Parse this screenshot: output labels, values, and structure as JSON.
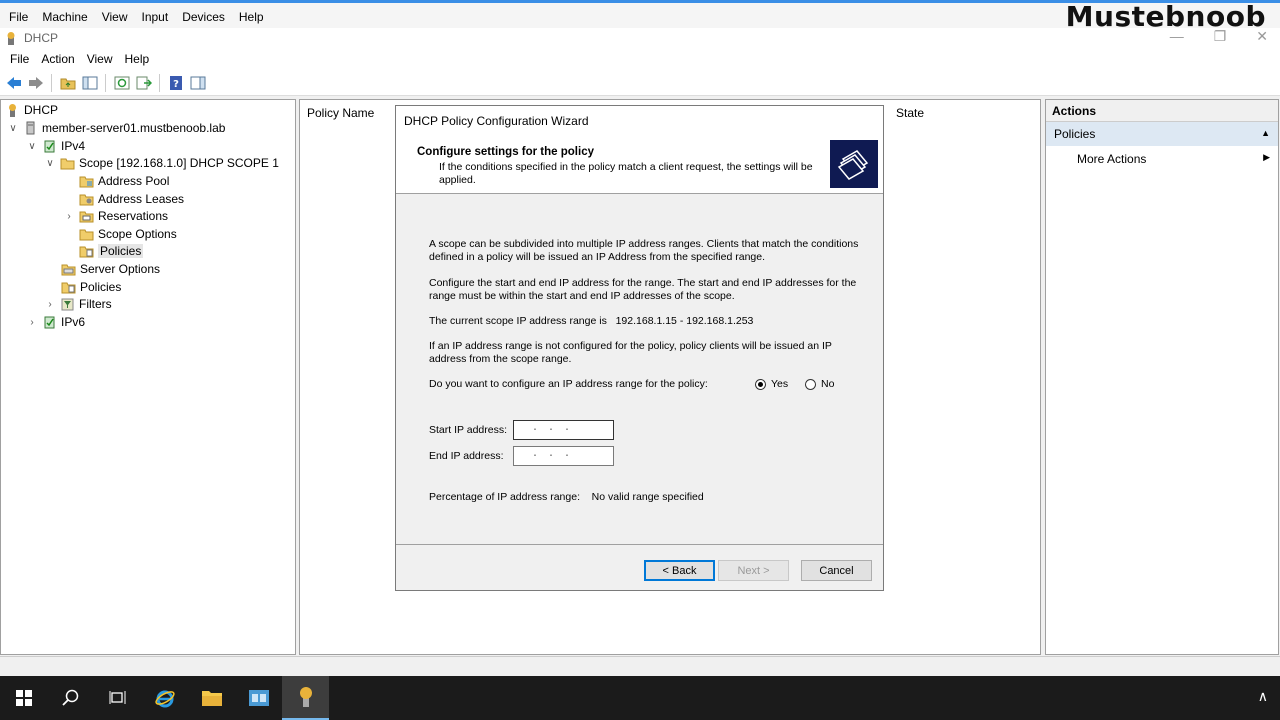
{
  "vm_menu": [
    "File",
    "Machine",
    "View",
    "Input",
    "Devices",
    "Help"
  ],
  "watermark": "Mustebnoob",
  "window": {
    "title": "DHCP"
  },
  "menu": [
    "File",
    "Action",
    "View",
    "Help"
  ],
  "tree": {
    "root": "DHCP",
    "server": "member-server01.mustbenoob.lab",
    "ipv4": "IPv4",
    "scope": "Scope [192.168.1.0] DHCP SCOPE 1",
    "address_pool": "Address Pool",
    "address_leases": "Address Leases",
    "reservations": "Reservations",
    "scope_options": "Scope Options",
    "policies_scope": "Policies",
    "server_options": "Server Options",
    "policies_server": "Policies",
    "filters": "Filters",
    "ipv6": "IPv6"
  },
  "center": {
    "col_policy_name": "Policy Name",
    "col_state": "State"
  },
  "actions": {
    "title": "Actions",
    "section": "Policies",
    "more_actions": "More Actions"
  },
  "wizard": {
    "title": "DHCP Policy Configuration Wizard",
    "header_title": "Configure settings for the policy",
    "header_sub": "If the conditions specified in the policy match a client request, the settings will be applied.",
    "p1": "A scope can be subdivided into multiple IP address ranges. Clients that match the conditions defined in a policy will be issued an IP Address from the specified range.",
    "p2": "Configure the start and end IP address for the range. The start and end IP addresses for the range must be within the start and end IP addresses of the scope.",
    "p3_label": "The current scope IP address range is",
    "p3_value": "192.168.1.15 - 192.168.1.253",
    "p4": "If an IP address range is not configured for the policy, policy clients will be issued an IP address from the scope range.",
    "question": "Do you want to configure an IP address range for the policy:",
    "yes": "Yes",
    "no": "No",
    "selected": "Yes",
    "start_label": "Start IP address:",
    "end_label": "End IP address:",
    "start_value": ".  .  .",
    "end_value": ".  .  .",
    "pct_label": "Percentage of IP address range:",
    "pct_value": "No valid range specified",
    "back": "< Back",
    "next": "Next >",
    "cancel": "Cancel"
  }
}
